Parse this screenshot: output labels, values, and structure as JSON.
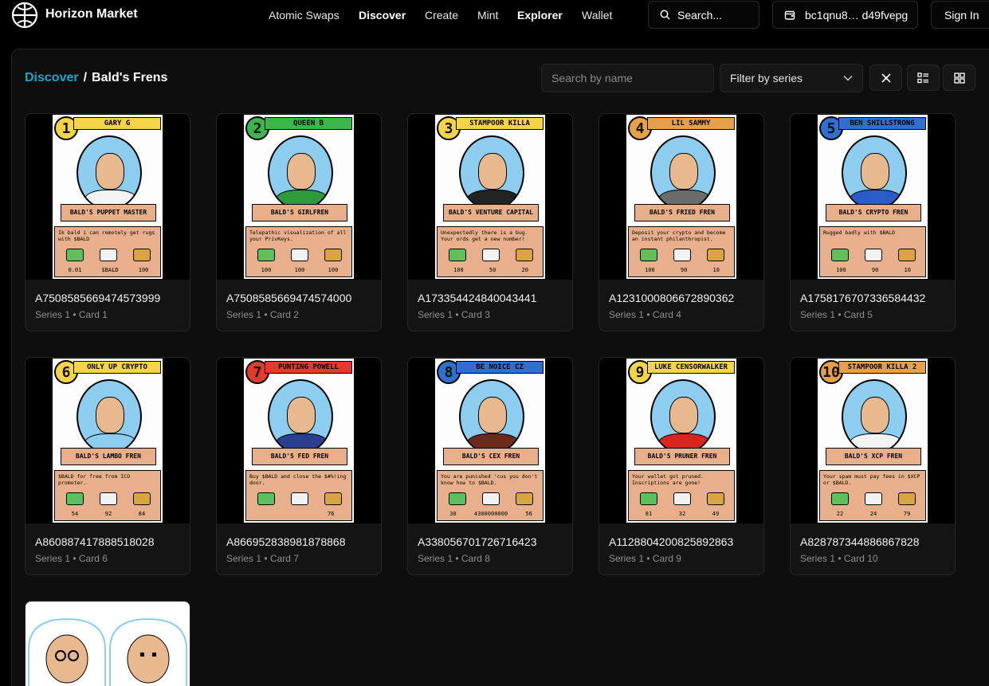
{
  "nav": {
    "brand": "Horizon Market",
    "links": [
      {
        "label": "Atomic Swaps",
        "bold": false
      },
      {
        "label": "Discover",
        "bold": true
      },
      {
        "label": "Create",
        "bold": false
      },
      {
        "label": "Mint",
        "bold": false
      },
      {
        "label": "Explorer",
        "bold": true
      },
      {
        "label": "Wallet",
        "bold": false
      }
    ],
    "search_label": "Search...",
    "wallet_label": "bc1qnu8… d49fvepg",
    "signin_label": "Sign In"
  },
  "breadcrumb": {
    "root": "Discover",
    "separator": "/",
    "current": "Bald's Frens"
  },
  "controls": {
    "search_placeholder": "Search by name",
    "filter_label": "Filter by series"
  },
  "colors": {
    "accent": "#1ba6c9",
    "background": "#000000",
    "panel": "#0e0e0e"
  },
  "cards": [
    {
      "id": "A7508585669474573999",
      "meta": "Series 1 • Card 1",
      "art": {
        "number": "1",
        "name": "GARY G",
        "banner": "BALD'S PUPPET MASTER",
        "desc": "Ik bald i can remotely get rugs with $BALD",
        "stats": [
          "0.01",
          "$BALD",
          "100"
        ],
        "color": "#f5d547",
        "shirt": "#f3f3f3"
      }
    },
    {
      "id": "A7508585669474574000",
      "meta": "Series 1 • Card 2",
      "art": {
        "number": "2",
        "name": "QUEEN B",
        "banner": "BALD'S GIRLFREN",
        "desc": "Telepathic visualization of all your PrivKeys.",
        "stats": [
          "100",
          "100",
          "100"
        ],
        "color": "#3cb54a",
        "shirt": "#2e9a3a"
      }
    },
    {
      "id": "A17335442484004344​1",
      "meta": "Series 1 • Card 3",
      "art": {
        "number": "3",
        "name": "STAMPOOR KILLA",
        "banner": "BALD'S VENTURE CAPITAL",
        "desc": "Unexpectedly there is a bug. Your ords get a new number!",
        "stats": [
          "100",
          "50",
          "20"
        ],
        "color": "#f5d547",
        "shirt": "#222222"
      }
    },
    {
      "id": "A1231000806672890362",
      "meta": "Series 1 • Card 4",
      "art": {
        "number": "4",
        "name": "LIL SAMMY",
        "banner": "BALD'S FRIED FREN",
        "desc": "Deposit your crypto and become an instant philanthropist.",
        "stats": [
          "100",
          "90",
          "10"
        ],
        "color": "#e6a04a",
        "shirt": "#6b6b6b"
      }
    },
    {
      "id": "A1758176707336584432",
      "meta": "Series 1 • Card 5",
      "art": {
        "number": "5",
        "name": "BEN SHILLSTRONG",
        "banner": "BALD'S CRYPTO FREN",
        "desc": "Rugged badly with $BALD",
        "stats": [
          "100",
          "90",
          "10"
        ],
        "color": "#2f6fd0",
        "shirt": "#2a5cc7"
      }
    },
    {
      "id": "A860887417888518028",
      "meta": "Series 1 • Card 6",
      "art": {
        "number": "6",
        "name": "ONLY UP CRYPTO",
        "banner": "BALD'S LAMBO FREN",
        "desc": "$BALD for free from ICO promoter.",
        "stats": [
          "54",
          "92",
          "84"
        ],
        "color": "#f5d547",
        "shirt": "#8ccdf0"
      }
    },
    {
      "id": "A866952838981878868",
      "meta": "Series 1 • Card 7",
      "art": {
        "number": "7",
        "name": "PUNTING POWELL",
        "banner": "BALD'S FED FREN",
        "desc": "Buy $BALD and close the $#%!ing door.",
        "stats": [
          "",
          "",
          "76"
        ],
        "color": "#e23a2c",
        "shirt": "#2a3f8f"
      }
    },
    {
      "id": "A338056701726716423",
      "meta": "Series 1 • Card 8",
      "art": {
        "number": "8",
        "name": "BE NOICE CZ",
        "banner": "BALD'S CEX FREN",
        "desc": "You are punished 'cus you don't know how to $BALD.",
        "stats": [
          "30",
          "4300000000",
          "56"
        ],
        "color": "#2f6fd0",
        "shirt": "#6b2a1a"
      }
    },
    {
      "id": "A1128804200825892863",
      "meta": "Series 1 • Card 9",
      "art": {
        "number": "9",
        "name": "LUKE CENSORWALKER",
        "banner": "BALD'S PRUNER FREN",
        "desc": "Your wallet got pruned. Inscriptions are gone!",
        "stats": [
          "81",
          "32",
          "49"
        ],
        "color": "#f5d547",
        "shirt": "#d8261f"
      }
    },
    {
      "id": "A828787344886867828",
      "meta": "Series 1 • Card 10",
      "art": {
        "number": "10",
        "name": "STAMPOOR KILLA 2",
        "banner": "BALD'S XCP FREN",
        "desc": "Your spam must pay fees in $XCP or $BALD.",
        "stats": [
          "22",
          "24",
          "79"
        ],
        "color": "#e6a04a",
        "shirt": "#f3f3f3"
      }
    }
  ]
}
